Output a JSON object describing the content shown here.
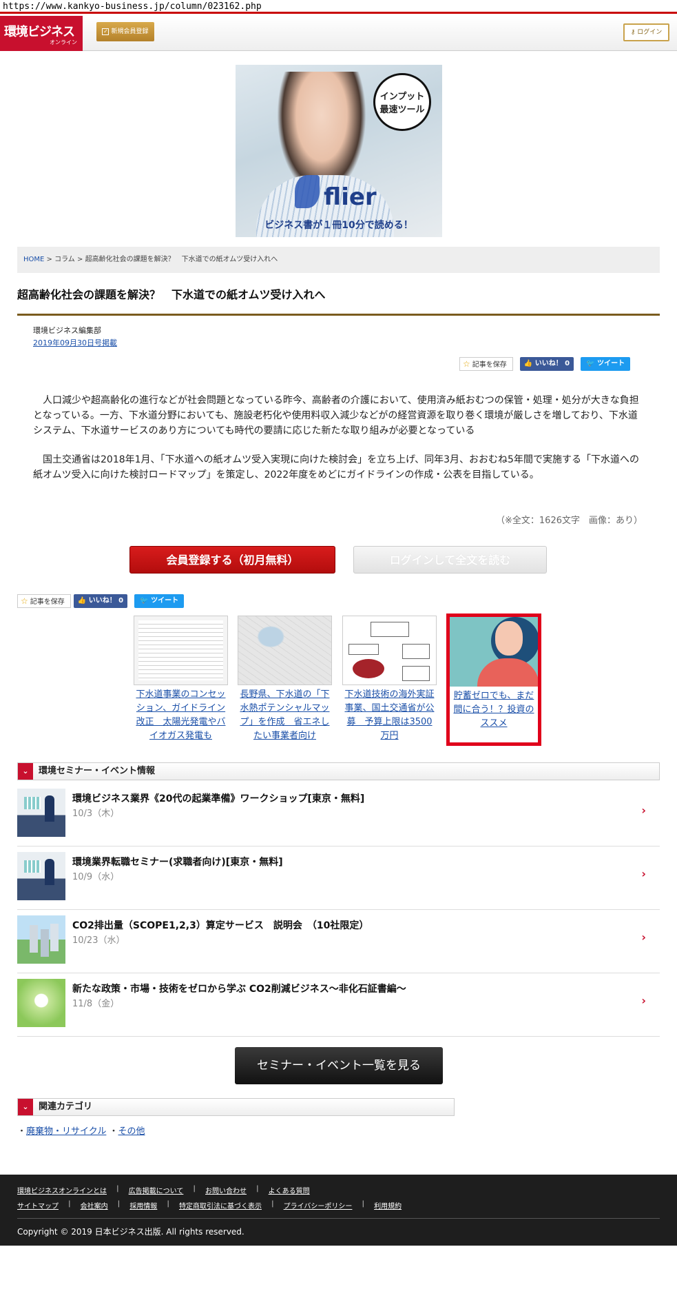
{
  "browser": {
    "url": "https://www.kankyo-business.jp/column/023162.php"
  },
  "header": {
    "logo_main": "環境ビジネス",
    "logo_sub": "オンライン",
    "register_label": "新規会員登録",
    "login_label": "ログイン"
  },
  "ad": {
    "badge_line1": "インプット",
    "badge_line2": "最速ツール",
    "brand": "flier",
    "tagline": "ビジネス書が１冊10分で読める！"
  },
  "breadcrumb": {
    "home": "HOME",
    "sep": ">",
    "column": "コラム",
    "current": "超高齢化社会の課題を解決？　下水道での紙オムツ受け入れへ"
  },
  "article": {
    "title": "超高齢化社会の課題を解決？　下水道での紙オムツ受け入れへ",
    "author": "環境ビジネス編集部",
    "date": "2019年09月30日号掲載",
    "paragraph1": "　人口減少や超高齢化の進行などが社会問題となっている昨今、高齢者の介護において、使用済み紙おむつの保管・処理・処分が大きな負担となっている。一方、下水道分野においても、施設老朽化や使用料収入減少などがの経営資源を取り巻く環境が厳しさを増しており、下水道システム、下水道サービスのあり方についても時代の要請に応じた新たな取り組みが必要となっている",
    "paragraph2": "　国土交通省は2018年1月、「下水道への紙オムツ受入実現に向けた検討会」を立ち上げ、同年3月、おおむね5年間で実施する「下水道への紙オムツ受入に向けた検討ロードマップ」を策定し、2022年度をめどにガイドラインの作成・公表を目指している。",
    "note": "（※全文：1626文字　画像：あり）"
  },
  "social": {
    "save_label": "記事を保存",
    "like_label": "いいね！ 0",
    "tweet_label": "ツイート"
  },
  "cta": {
    "register": "会員登録する（初月無料）",
    "login_read": "ログインして全文を読む"
  },
  "related_articles": [
    {
      "caption": "下水道事業のコンセッション、ガイドライン改正　太陽光発電やバイオガス発電も"
    },
    {
      "caption": "長野県、下水道の「下水熱ポテンシャルマップ」を作成　省エネしたい事業者向け"
    },
    {
      "caption": "下水道技術の海外実証事業、国土交通省が公募　予算上限は3500万円"
    },
    {
      "caption": "貯蓄ゼロでも、まだ間に合う！？投資のススメ"
    }
  ],
  "seminars": {
    "heading": "環境セミナー・イベント情報",
    "items": [
      {
        "title": "環境ビジネス業界《20代の起業準備》ワークショップ[東京・無料]",
        "date": "10/3（木）"
      },
      {
        "title": "環境業界転職セミナー(求職者向け)[東京・無料]",
        "date": "10/9（水）"
      },
      {
        "title": "CO2排出量（SCOPE1,2,3）算定サービス　説明会　（10社限定）",
        "date": "10/23（水）"
      },
      {
        "title": "新たな政策・市場・技術をゼロから学ぶ CO2削減ビジネス～非化石証書編～",
        "date": "11/8（金）"
      }
    ],
    "more_label": "セミナー・イベント一覧を見る"
  },
  "categories": {
    "heading": "関連カテゴリ",
    "items": [
      "廃棄物・リサイクル",
      "その他"
    ]
  },
  "footer": {
    "row1": [
      "環境ビジネスオンラインとは",
      "広告掲載について",
      "お問い合わせ",
      "よくある質問"
    ],
    "row2": [
      "サイトマップ",
      "会社案内",
      "採用情報",
      "特定商取引法に基づく表示",
      "プライバシーポリシー",
      "利用規約"
    ],
    "copyright": "Copyright © 2019 日本ビジネス出版. All rights reserved."
  }
}
